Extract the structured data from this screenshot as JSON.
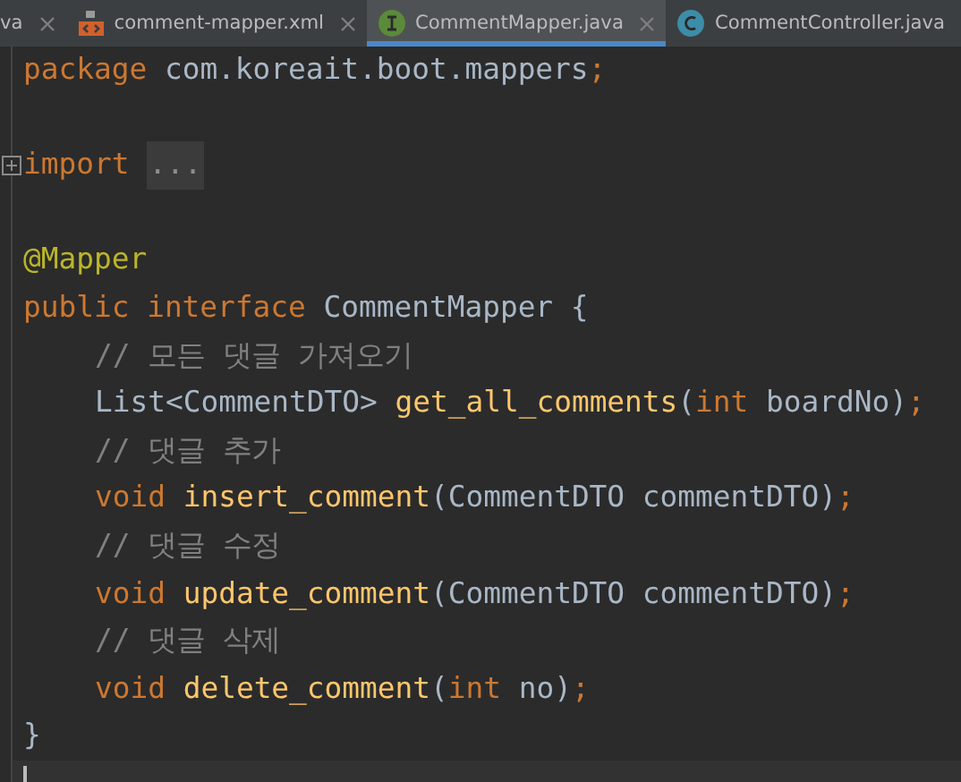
{
  "tabs": [
    {
      "label": "va",
      "kind": "plain",
      "selected": false,
      "closable": true
    },
    {
      "label": "comment-mapper.xml",
      "kind": "xml",
      "selected": false,
      "closable": true
    },
    {
      "label": "CommentMapper.java",
      "kind": "interface",
      "selected": true,
      "closable": true
    },
    {
      "label": "CommentController.java",
      "kind": "class",
      "selected": false,
      "closable": false
    }
  ],
  "lines": [
    {
      "kind": "top",
      "tokens": [
        {
          "kind": "keyword",
          "text": "package "
        },
        {
          "kind": "plain",
          "text": "com.koreait.boot.mappers"
        },
        {
          "kind": "keyword",
          "text": ";"
        }
      ]
    },
    {
      "kind": "blank"
    },
    {
      "kind": "top",
      "tokens": [
        {
          "kind": "keyword",
          "text": "import "
        },
        {
          "kind": "fold",
          "text": "..."
        }
      ]
    },
    {
      "kind": "blank"
    },
    {
      "kind": "top",
      "tokens": [
        {
          "kind": "annotation",
          "text": "@Mapper"
        }
      ]
    },
    {
      "kind": "top",
      "tokens": [
        {
          "kind": "keyword",
          "text": "public interface "
        },
        {
          "kind": "plain",
          "text": "CommentMapper {"
        }
      ]
    },
    {
      "kind": "member",
      "tokens": [
        {
          "kind": "comment",
          "text": "// 모든 댓글 가져오기"
        }
      ]
    },
    {
      "kind": "member",
      "tokens": [
        {
          "kind": "plain",
          "text": "List<CommentDTO> "
        },
        {
          "kind": "function",
          "text": "get_all_comments"
        },
        {
          "kind": "plain",
          "text": "("
        },
        {
          "kind": "keyword",
          "text": "int "
        },
        {
          "kind": "plain",
          "text": "boardNo)"
        },
        {
          "kind": "keyword",
          "text": ";"
        }
      ]
    },
    {
      "kind": "member",
      "tokens": [
        {
          "kind": "comment",
          "text": "// 댓글 추가"
        }
      ]
    },
    {
      "kind": "member",
      "tokens": [
        {
          "kind": "keyword",
          "text": "void "
        },
        {
          "kind": "function",
          "text": "insert_comment"
        },
        {
          "kind": "plain",
          "text": "(CommentDTO commentDTO)"
        },
        {
          "kind": "keyword",
          "text": ";"
        }
      ]
    },
    {
      "kind": "member",
      "tokens": [
        {
          "kind": "comment",
          "text": "// 댓글 수정"
        }
      ]
    },
    {
      "kind": "member",
      "tokens": [
        {
          "kind": "keyword",
          "text": "void "
        },
        {
          "kind": "function",
          "text": "update_comment"
        },
        {
          "kind": "plain",
          "text": "(CommentDTO commentDTO)"
        },
        {
          "kind": "keyword",
          "text": ";"
        }
      ]
    },
    {
      "kind": "member",
      "tokens": [
        {
          "kind": "comment",
          "text": "// 댓글 삭제"
        }
      ]
    },
    {
      "kind": "member",
      "tokens": [
        {
          "kind": "keyword",
          "text": "void "
        },
        {
          "kind": "function",
          "text": "delete_comment"
        },
        {
          "kind": "plain",
          "text": "("
        },
        {
          "kind": "keyword",
          "text": "int "
        },
        {
          "kind": "plain",
          "text": "no)"
        },
        {
          "kind": "keyword",
          "text": ";"
        }
      ]
    },
    {
      "kind": "top",
      "tokens": [
        {
          "kind": "plain",
          "text": "}"
        }
      ]
    },
    {
      "kind": "cursor"
    }
  ]
}
